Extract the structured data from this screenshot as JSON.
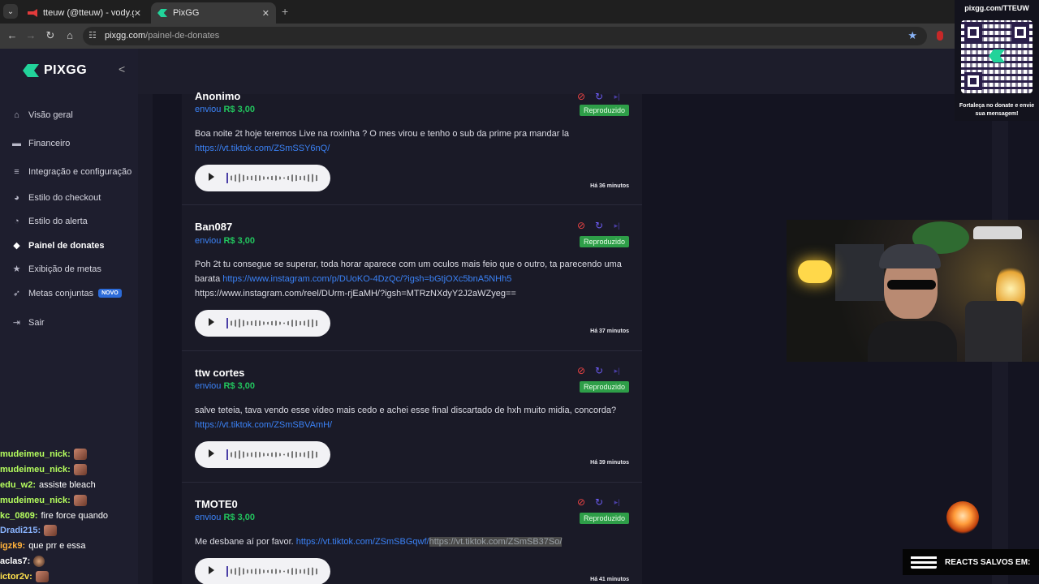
{
  "browser": {
    "tabs": [
      {
        "title": "tteuw (@tteuw) - vody.gg",
        "close": "✕"
      },
      {
        "title": "PixGG",
        "close": "✕"
      }
    ],
    "new_tab": "+",
    "url_host": "pixgg.com",
    "url_path": "/painel-de-donates"
  },
  "sidebar": {
    "logo": "PIXGG",
    "collapse": "<",
    "items": [
      {
        "label": "Visão geral",
        "icon": "home-icon"
      },
      {
        "label": "Financeiro",
        "icon": "wallet-icon"
      },
      {
        "label": "Integração e configuração",
        "icon": "sliders-icon"
      },
      {
        "label": "Estilo do checkout",
        "icon": "palette-icon"
      },
      {
        "label": "Estilo do alerta",
        "icon": "palette-icon"
      },
      {
        "label": "Painel de donates",
        "icon": "tag-icon",
        "active": true
      },
      {
        "label": "Exibição de metas",
        "icon": "star-icon"
      },
      {
        "label": "Metas conjuntas",
        "icon": "rocket-icon",
        "badge": "NOVO"
      },
      {
        "label": "Sair",
        "icon": "logout-icon"
      }
    ]
  },
  "donations": [
    {
      "name": "Anonimo",
      "sent_label": "enviou",
      "amount": "R$ 3,00",
      "status": "Reproduzido",
      "message": "Boa noite 2t hoje teremos Live na roxinha ? O mes virou e tenho o sub da prime pra mandar la ",
      "links": [
        "https://vt.tiktok.com/ZSmSSY6nQ/"
      ],
      "time": "Há 36 minutos"
    },
    {
      "name": "Ban087",
      "sent_label": "enviou",
      "amount": "R$ 3,00",
      "status": "Reproduzido",
      "message": "Poh 2t tu consegue se superar, toda horar aparece com um oculos mais feio que o outro, ta parecendo uma barata ",
      "links": [
        "https://www.instagram.com/p/DUoKO-4DzQc/?igsh=bGtjOXc5bnA5NHh5"
      ],
      "message_tail": "https://www.instagram.com/reel/DUrm-rjEaMH/?igsh=MTRzNXdyY2J2aWZyeg==",
      "time": "Há 37 minutos"
    },
    {
      "name": "ttw cortes",
      "sent_label": "enviou",
      "amount": "R$ 3,00",
      "status": "Reproduzido",
      "message": "salve teteia, tava vendo esse video mais cedo e achei esse final discartado de hxh muito midia, concorda? ",
      "links": [
        "https://vt.tiktok.com/ZSmSBVAmH/"
      ],
      "time": "Há 39 minutos"
    },
    {
      "name": "TMOTE0",
      "sent_label": "enviou",
      "amount": "R$ 3,00",
      "status": "Reproduzido",
      "message": "Me desbane aí por favor. ",
      "links": [
        "https://vt.tiktok.com/ZSmSBGqwf/",
        "https://vt.tiktok.com/ZSmSB37So/"
      ],
      "time": "Há 41 minutos"
    }
  ],
  "overlay": {
    "qr_title": "pixgg.com/TTEUW",
    "qr_caption": "Fortaleça no donate e envie sua mensagem!",
    "reacts": "REACTS SALVOS EM:"
  },
  "chat": [
    {
      "user": "mudeimeu_nick:",
      "color": "#b6ff5e",
      "text": "",
      "emote": "face"
    },
    {
      "user": "mudeimeu_nick:",
      "color": "#b6ff5e",
      "text": "",
      "emote": "face"
    },
    {
      "user": "edu_w2:",
      "color": "#b6ff5e",
      "text": "assiste bleach",
      "emote": ""
    },
    {
      "user": "mudeimeu_nick:",
      "color": "#b6ff5e",
      "text": "",
      "emote": "face"
    },
    {
      "user": "kc_0809:",
      "color": "#b6ff5e",
      "text": "fire force quando",
      "emote": ""
    },
    {
      "user": "Dradi215:",
      "color": "#8ab4ff",
      "text": "",
      "emote": "face"
    },
    {
      "user": "igzk9:",
      "color": "#ffb13b",
      "text": "que prr e essa",
      "emote": ""
    },
    {
      "user": "aclas7:",
      "color": "#ffffff",
      "text": "",
      "emote": "cat"
    },
    {
      "user": "ictor2v:",
      "color": "#ffe14d",
      "text": "",
      "emote": "face"
    }
  ]
}
